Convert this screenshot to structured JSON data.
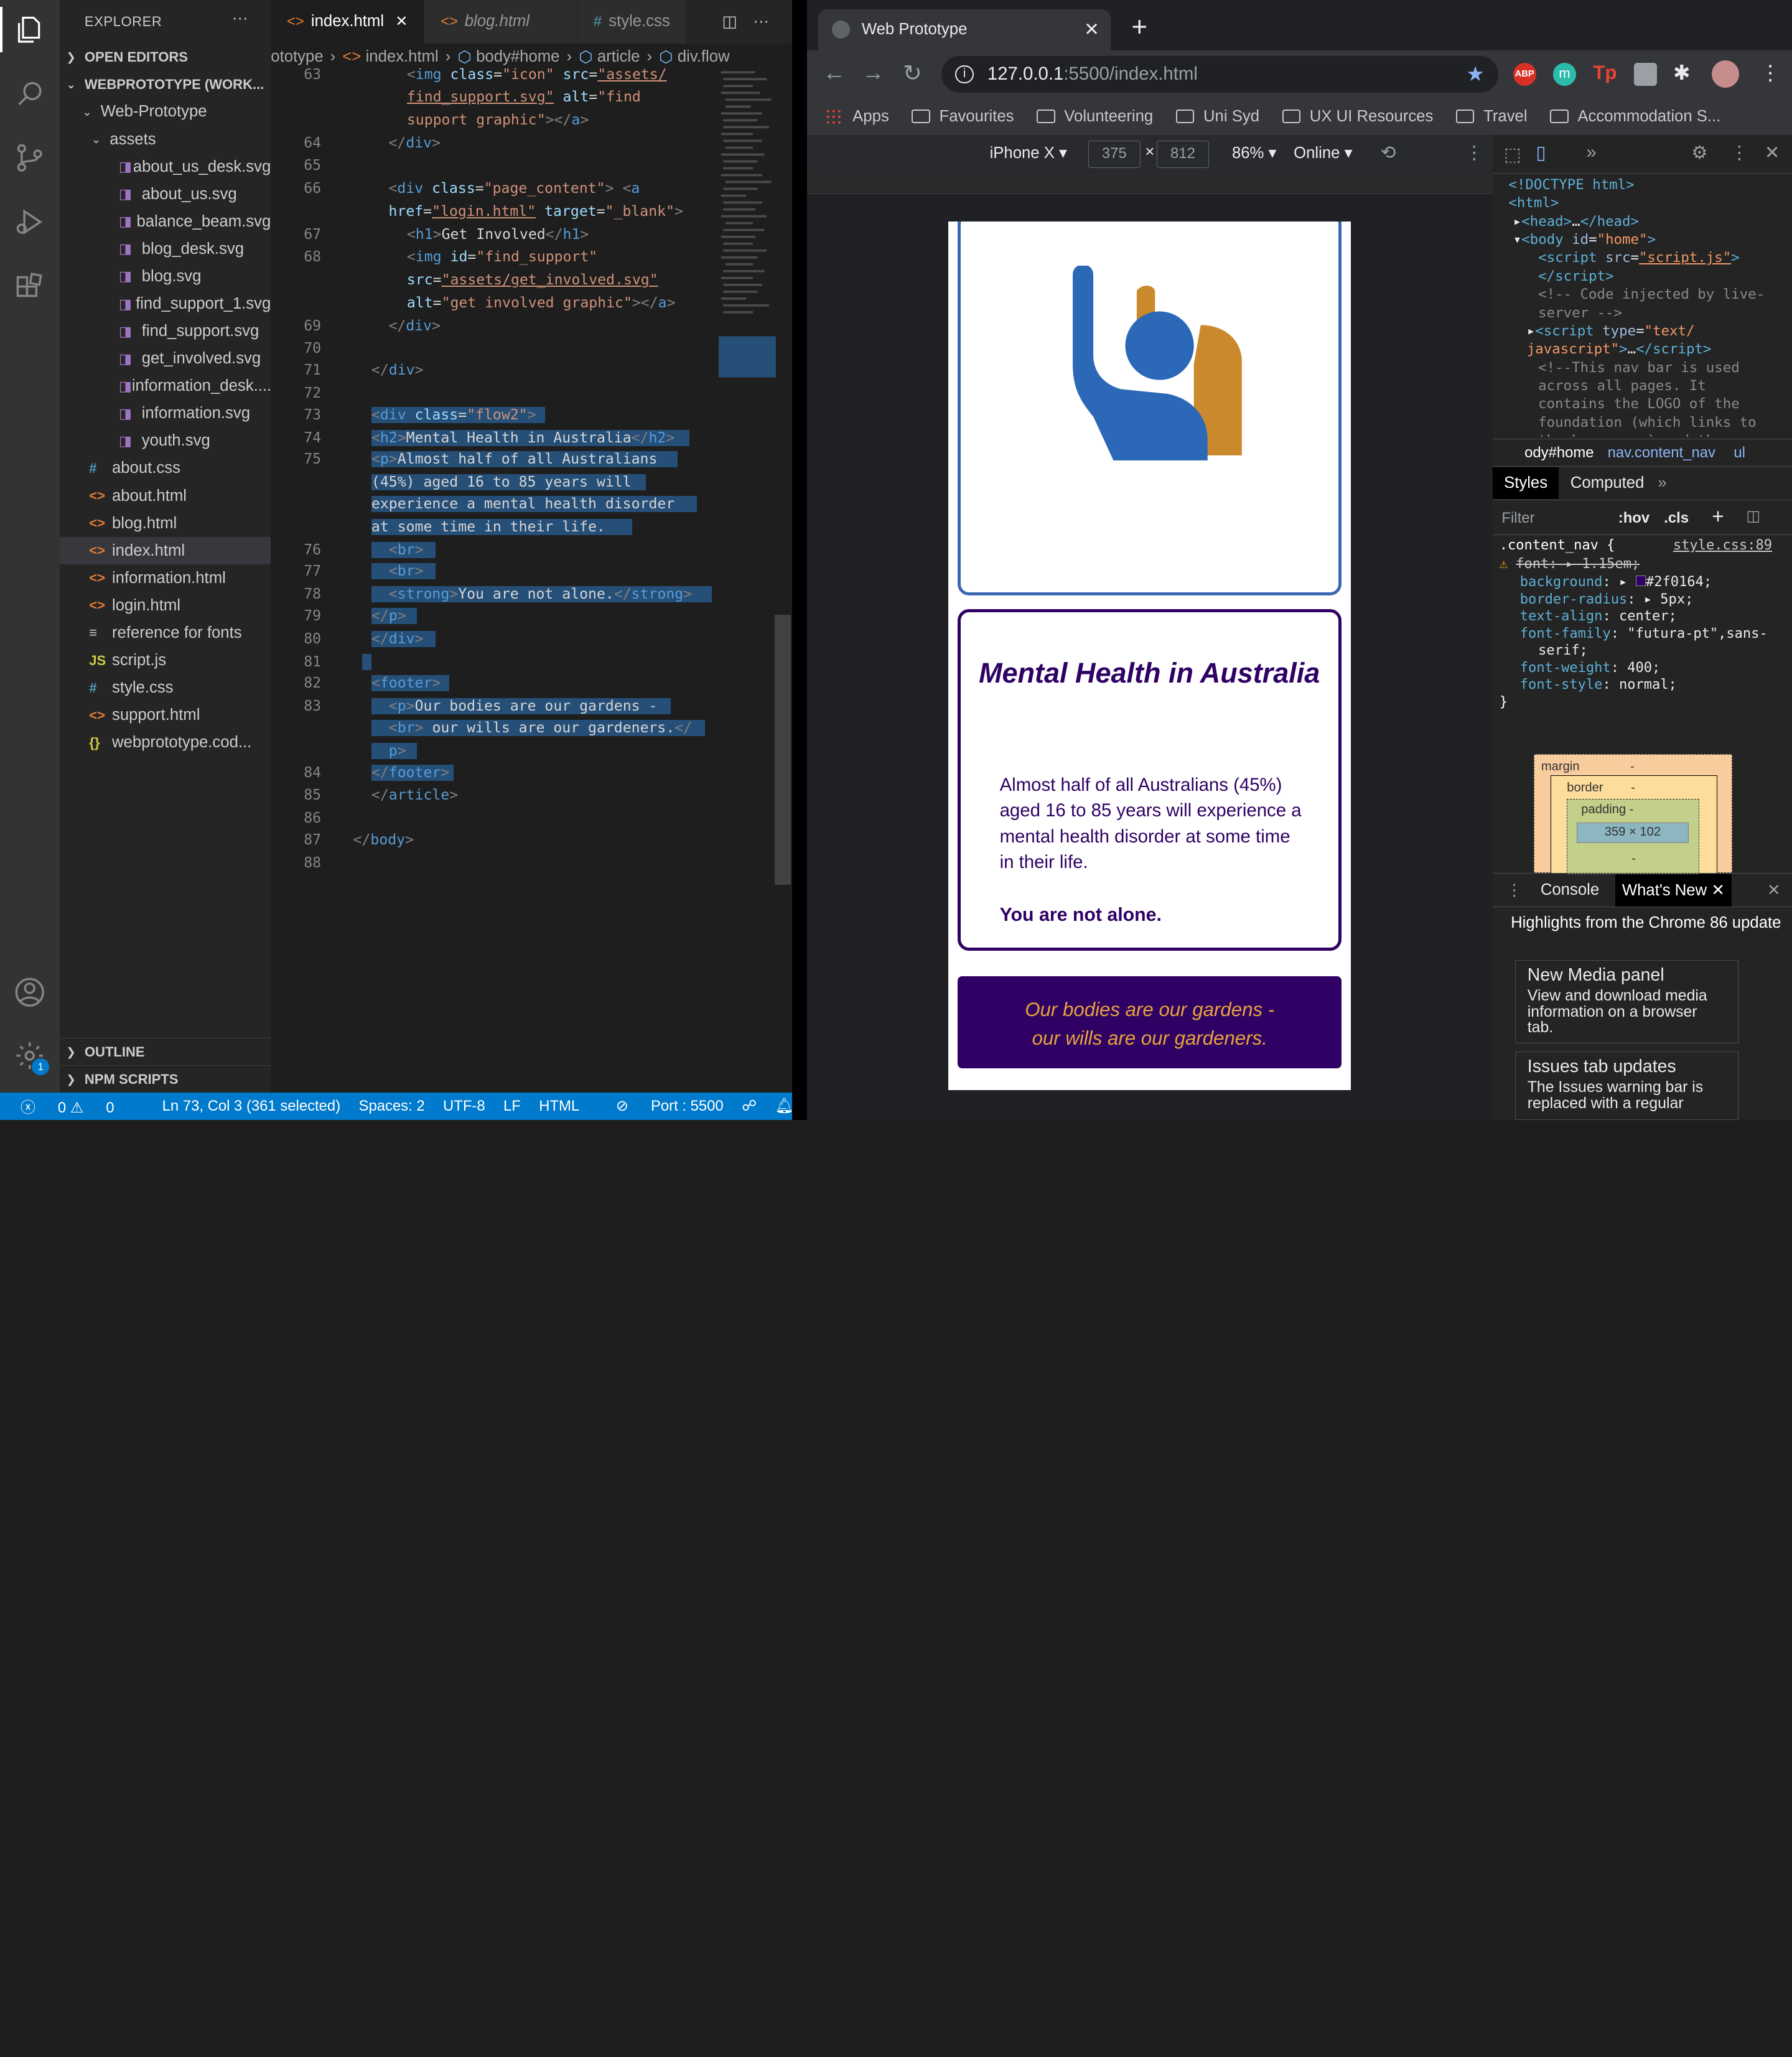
{
  "vscode": {
    "explorer_title": "EXPLORER",
    "open_editors": "OPEN EDITORS",
    "workspace": "WEBPROTOTYPE (WORK...",
    "folder": "Web-Prototype",
    "subfolder": "assets",
    "assets": [
      "about_us_desk.svg",
      "about_us.svg",
      "balance_beam.svg",
      "blog_desk.svg",
      "blog.svg",
      "find_support_1.svg",
      "find_support.svg",
      "get_involved.svg",
      "information_desk....",
      "information.svg",
      "youth.svg"
    ],
    "files": [
      {
        "icon": "#",
        "name": "about.css"
      },
      {
        "icon": "<>",
        "name": "about.html"
      },
      {
        "icon": "<>",
        "name": "blog.html"
      },
      {
        "icon": "<>",
        "name": "index.html"
      },
      {
        "icon": "<>",
        "name": "information.html"
      },
      {
        "icon": "<>",
        "name": "login.html"
      },
      {
        "icon": "≡",
        "name": "reference for fonts"
      },
      {
        "icon": "JS",
        "name": "script.js"
      },
      {
        "icon": "#",
        "name": "style.css"
      },
      {
        "icon": "<>",
        "name": "support.html"
      },
      {
        "icon": "{}",
        "name": "webprototype.cod..."
      }
    ],
    "outline": "OUTLINE",
    "npm": "NPM SCRIPTS",
    "tabs": [
      "index.html",
      "blog.html",
      "style.css"
    ],
    "breadcrumb": [
      "ototype",
      "index.html",
      "body#home",
      "article",
      "div.flow"
    ],
    "status": {
      "errors": "0",
      "warnings": "0",
      "position": "Ln 73, Col 3 (361 selected)",
      "spaces": "Spaces: 2",
      "encoding": "UTF-8",
      "eol": "LF",
      "lang": "HTML",
      "port": "Port : 5500"
    },
    "badge": "1",
    "line_numbers": [
      "63",
      "64",
      "65",
      "66",
      "67",
      "68",
      "69",
      "70",
      "71",
      "72",
      "73",
      "74",
      "75",
      "76",
      "77",
      "78",
      "79",
      "80",
      "81",
      "82",
      "83",
      "84",
      "85",
      "86",
      "87",
      "88"
    ]
  },
  "chrome": {
    "tab_title": "Web Prototype",
    "url_host": "127.0.0.1",
    "url_rest": ":5500/index.html",
    "bookmarks": [
      "Apps",
      "Favourites",
      "Volunteering",
      "Uni Syd",
      "UX UI Resources",
      "Travel",
      "Accommodation S..."
    ],
    "device": "iPhone X",
    "width": "375",
    "height": "812",
    "zoom": "86%",
    "network": "Online",
    "page": {
      "heading": "Mental Health in Australia",
      "body": "Almost half of all Australians (45%) aged 16 to 85 years will experience a mental health disorder at some time in their life.",
      "strong": "You are not alone.",
      "footer_line1": "Our bodies are our gardens -",
      "footer_line2": "our wills are our gardeners."
    }
  },
  "devtools": {
    "crumb": [
      "ody#home",
      "nav.content_nav",
      "ul"
    ],
    "tabs": [
      "Styles",
      "Computed"
    ],
    "filter": "Filter",
    "hov": ":hov",
    "cls": ".cls",
    "selector": ".content_nav {",
    "source": "style.css:89",
    "drawer_tabs": [
      "Console",
      "What's New"
    ],
    "highlights": "Highlights from the Chrome 86 update",
    "cards": [
      {
        "title": "New Media panel",
        "text": "View and download media information on a browser tab."
      },
      {
        "title": "Issues tab updates",
        "text": "The Issues warning bar is replaced with a regular"
      }
    ],
    "box_margin": "margin",
    "box_border": "border",
    "box_padding": "padding -",
    "box_size": "359 × 102",
    "dash": "-"
  }
}
